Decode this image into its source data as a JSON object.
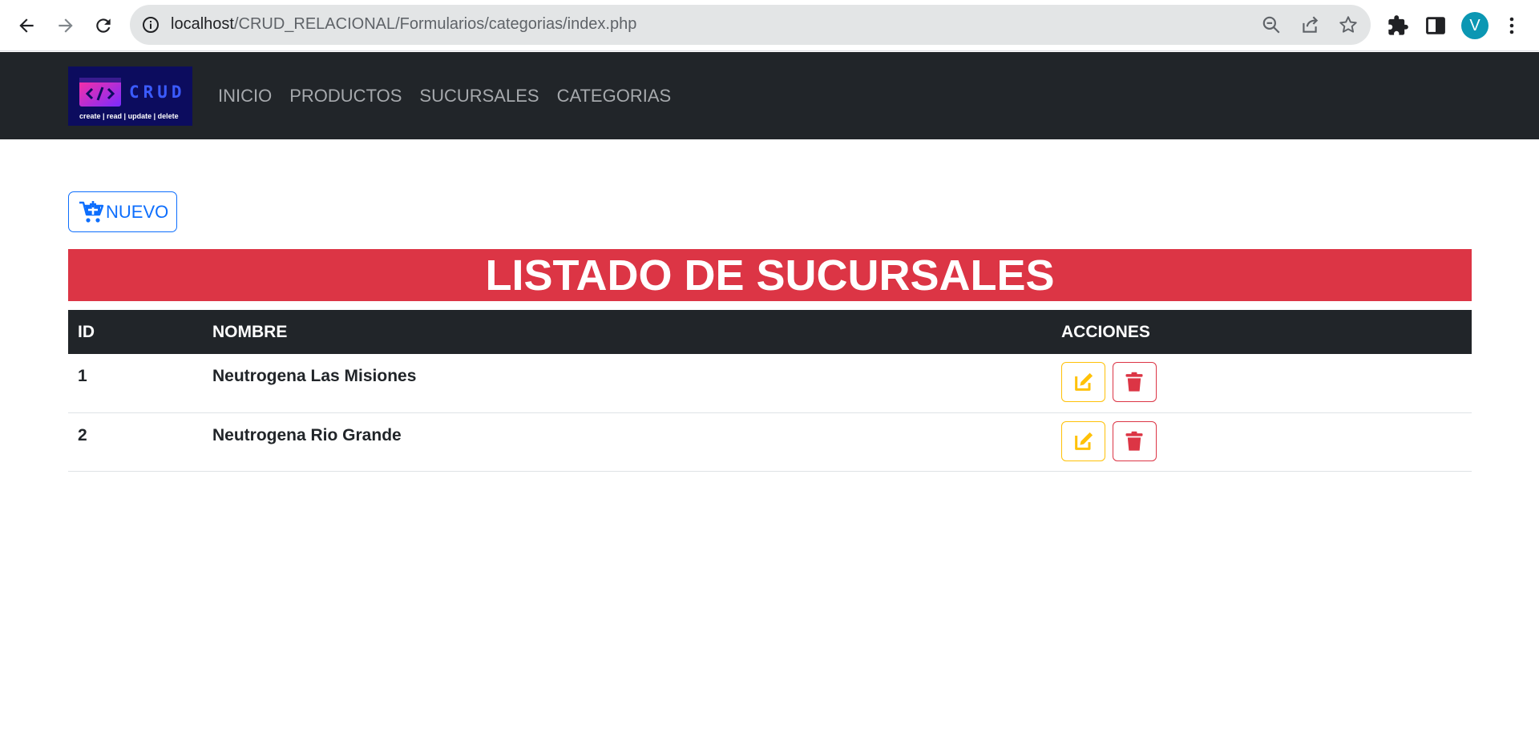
{
  "browser": {
    "url_host": "localhost",
    "url_path": "/CRUD_RELACIONAL/Formularios/categorias/index.php",
    "profile_initial": "V"
  },
  "navbar": {
    "logo": {
      "word": "CRUD",
      "subtitle": "create | read | update | delete",
      "code_glyph": "</>"
    },
    "links": [
      "INICIO",
      "PRODUCTOS",
      "SUCURSALES",
      "CATEGORIAS"
    ]
  },
  "toolbar": {
    "new_label": "NUEVO"
  },
  "page": {
    "title": "LISTADO DE SUCURSALES"
  },
  "table": {
    "headers": [
      "ID",
      "NOMBRE",
      "ACCIONES"
    ],
    "rows": [
      {
        "id": "1",
        "name": "Neutrogena Las Misiones"
      },
      {
        "id": "2",
        "name": "Neutrogena Rio Grande"
      }
    ]
  },
  "colors": {
    "primary": "#0d6efd",
    "danger": "#dc3545",
    "warning": "#ffc107",
    "dark": "#212529"
  },
  "icons": {
    "back": "arrow-left-icon",
    "forward": "arrow-right-icon",
    "reload": "reload-icon",
    "site_info": "info-icon",
    "zoom": "zoom-out-icon",
    "share": "share-icon",
    "bookmark": "star-icon",
    "extensions": "puzzle-icon",
    "side_panel": "side-panel-icon",
    "menu": "kebab-menu-icon",
    "new": "cart-plus-icon",
    "edit": "edit-icon",
    "delete": "trash-icon"
  }
}
